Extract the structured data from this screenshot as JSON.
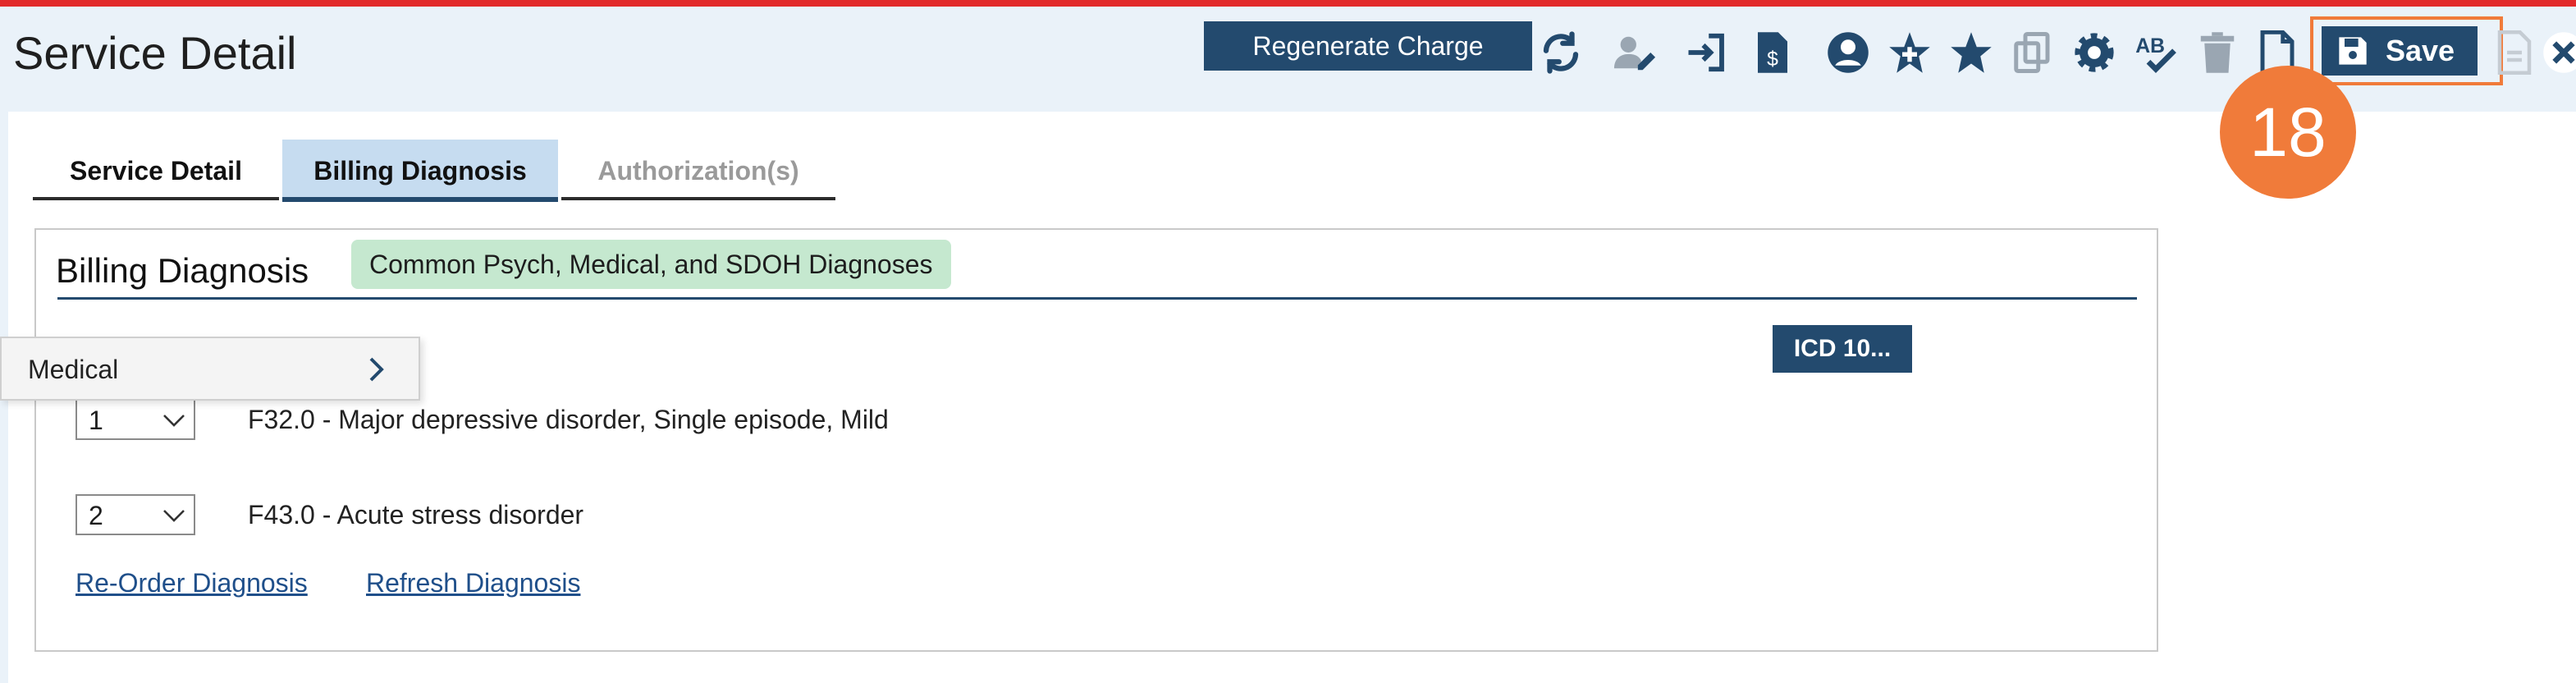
{
  "page": {
    "title": "Service Detail"
  },
  "toolbar": {
    "regenerate_label": "Regenerate Charge",
    "save_label": "Save",
    "icons": [
      "refresh-icon",
      "user-edit-icon",
      "sign-in-icon",
      "invoice-dollar-icon",
      "user-circle-icon",
      "star-plus-icon",
      "star-icon",
      "copy-icon",
      "gear-icon",
      "spellcheck-icon",
      "trash-icon",
      "new-document-icon",
      "save-disk-icon",
      "disabled-document-icon",
      "close-icon"
    ]
  },
  "step_badge": "18",
  "tabs": [
    {
      "label": "Service Detail"
    },
    {
      "label": "Billing Diagnosis"
    },
    {
      "label": "Authorization(s)"
    }
  ],
  "billing": {
    "title": "Billing Diagnosis",
    "badge": "Common Psych, Medical, and SDOH Diagnoses",
    "icd_button": "ICD 10..."
  },
  "flyout": {
    "label": "Medical"
  },
  "diagnoses": [
    {
      "order": "1",
      "text": "F32.0 - Major depressive disorder, Single episode, Mild"
    },
    {
      "order": "2",
      "text": "F43.0 - Acute stress disorder"
    }
  ],
  "links": {
    "reorder": "Re-Order Diagnosis",
    "refresh": "Refresh Diagnosis"
  },
  "colors": {
    "primary": "#234a6e",
    "accent": "#f07b3a",
    "badge_bg": "#c5e8cf",
    "tab_active": "#c6dcf0",
    "top_line": "#e22a2a"
  }
}
